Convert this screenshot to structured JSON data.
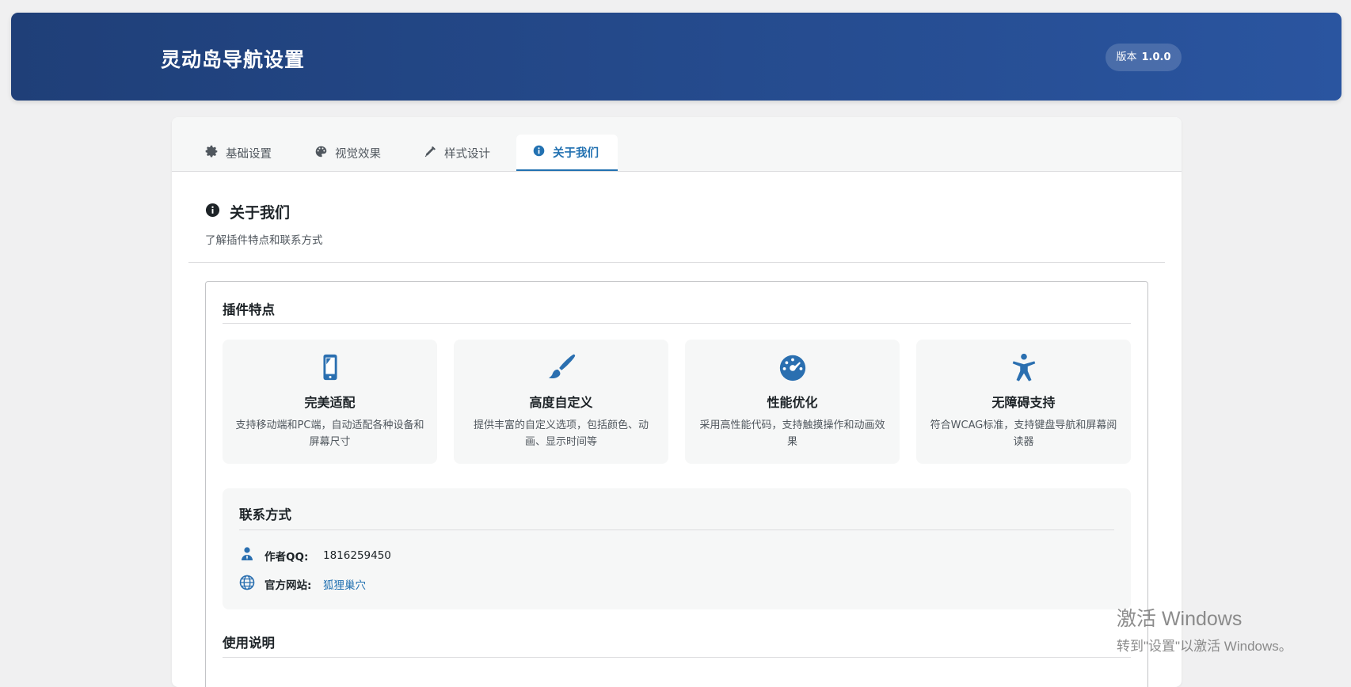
{
  "header": {
    "title": "灵动岛导航设置",
    "version_label": "版本",
    "version_value": "1.0.0"
  },
  "tabs": [
    {
      "label": "基础设置",
      "icon": "gear-icon",
      "active": false
    },
    {
      "label": "视觉效果",
      "icon": "palette-icon",
      "active": false
    },
    {
      "label": "样式设计",
      "icon": "hammer-icon",
      "active": false
    },
    {
      "label": "关于我们",
      "icon": "info-icon",
      "active": true
    }
  ],
  "section": {
    "title": "关于我们",
    "description": "了解插件特点和联系方式"
  },
  "features": {
    "heading": "插件特点",
    "items": [
      {
        "title": "完美适配",
        "description": "支持移动端和PC端，自动适配各种设备和屏幕尺寸",
        "icon": "smartphone-icon"
      },
      {
        "title": "高度自定义",
        "description": "提供丰富的自定义选项，包括颜色、动画、显示时间等",
        "icon": "paintbrush-icon"
      },
      {
        "title": "性能优化",
        "description": "采用高性能代码，支持触摸操作和动画效果",
        "icon": "dashboard-icon"
      },
      {
        "title": "无障碍支持",
        "description": "符合WCAG标准，支持键盘导航和屏幕阅读器",
        "icon": "accessibility-icon"
      }
    ]
  },
  "contact": {
    "heading": "联系方式",
    "qq_label": "作者QQ:",
    "qq_value": "1816259450",
    "site_label": "官方网站:",
    "site_value": "狐狸巢穴"
  },
  "usage": {
    "heading": "使用说明"
  },
  "watermark": {
    "line1": "激活 Windows",
    "line2": "转到\"设置\"以激活 Windows。"
  },
  "colors": {
    "header_gradient_start": "#1f3f78",
    "header_gradient_end": "#2a55a0",
    "accent": "#2271b1",
    "icon_blue": "#2a6fb0"
  }
}
